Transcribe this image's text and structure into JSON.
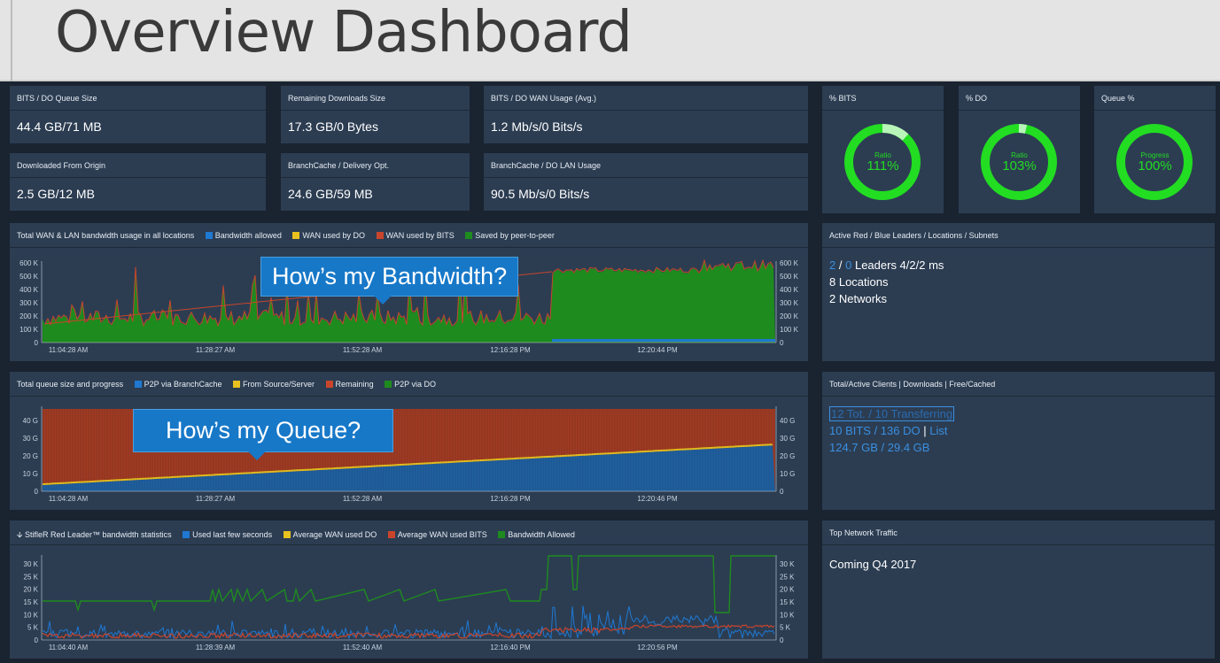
{
  "header": {
    "title": "Overview Dashboard"
  },
  "stats": [
    {
      "label": "BITS / DO Queue Size",
      "value": "44.4 GB/71 MB"
    },
    {
      "label": "Remaining Downloads Size",
      "value": "17.3 GB/0 Bytes"
    },
    {
      "label": "BITS / DO WAN Usage (Avg.)",
      "value": "1.2 Mb/s/0 Bits/s"
    },
    {
      "label": "Downloaded From Origin",
      "value": "2.5 GB/12 MB"
    },
    {
      "label": "BranchCache / Delivery Opt.",
      "value": "24.6 GB/59 MB"
    },
    {
      "label": "BranchCache / DO LAN Usage",
      "value": "90.5 Mb/s/0 Bits/s"
    }
  ],
  "donuts": [
    {
      "title": "% BITS",
      "caption": "Ratio",
      "value": "111%",
      "fraction": 1.11
    },
    {
      "title": "% DO",
      "caption": "Ratio",
      "value": "103%",
      "fraction": 1.03
    },
    {
      "title": "Queue %",
      "caption": "Progress",
      "value": "100%",
      "fraction": 1.0
    }
  ],
  "colors": {
    "blue": "#1f78d1",
    "yellow": "#e8c21e",
    "red": "#c8452b",
    "green": "#1e8b1e",
    "donut": "#22dd22"
  },
  "bandwidth": {
    "title": "Total WAN & LAN bandwidth usage in all locations",
    "legend": [
      "Bandwidth allowed",
      "WAN used by DO",
      "WAN used by BITS",
      "Saved by peer-to-peer"
    ],
    "callout": "How’s my Bandwidth?",
    "y_ticks": [
      "600 K",
      "500 K",
      "400 K",
      "300 K",
      "200 K",
      "100 K",
      "0"
    ],
    "x_ticks": [
      "11:04:28 AM",
      "11:28:27 AM",
      "11:52:28 AM",
      "12:16:28 PM",
      "12:20:44 PM"
    ]
  },
  "queue": {
    "title": "Total queue size and progress",
    "legend": [
      "P2P via BranchCache",
      "From Source/Server",
      "Remaining",
      "P2P via DO"
    ],
    "callout": "How’s my Queue?",
    "y_ticks": [
      "40 G",
      "30 G",
      "20 G",
      "10 G",
      "0"
    ],
    "x_ticks": [
      "11:04:28 AM",
      "11:28:27 AM",
      "11:52:28 AM",
      "12:16:28 PM",
      "12:20:46 PM"
    ]
  },
  "stifler": {
    "title": "StifleR Red Leader™ bandwidth statistics",
    "legend": [
      "Used last few seconds",
      "Average WAN used DO",
      "Average WAN used BITS",
      "Bandwidth Allowed"
    ],
    "y_ticks": [
      "30 K",
      "25 K",
      "20 K",
      "15 K",
      "10 K",
      "5 K",
      "0"
    ],
    "x_ticks": [
      "11:04:40 AM",
      "11:28:39 AM",
      "11:52:40 AM",
      "12:16:40 PM",
      "12:20:56 PM"
    ]
  },
  "leaders": {
    "title": "Active Red / Blue Leaders / Locations / Subnets",
    "red": "2",
    "sep": "/",
    "blue": "0",
    "leaders_text": "Leaders 4/2/2 ms",
    "locations": "8 Locations",
    "networks": "2 Networks"
  },
  "clients": {
    "title": "Total/Active Clients | Downloads | Free/Cached",
    "line1": "12 Tot. / 10 Transferring",
    "line2a": "10 BITS / 136 DO",
    "line2sep": "|",
    "line2b": "List",
    "line3": "124.7 GB / 29.4 GB"
  },
  "traffic": {
    "title": "Top Network Traffic",
    "text": "Coming Q4 2017"
  }
}
